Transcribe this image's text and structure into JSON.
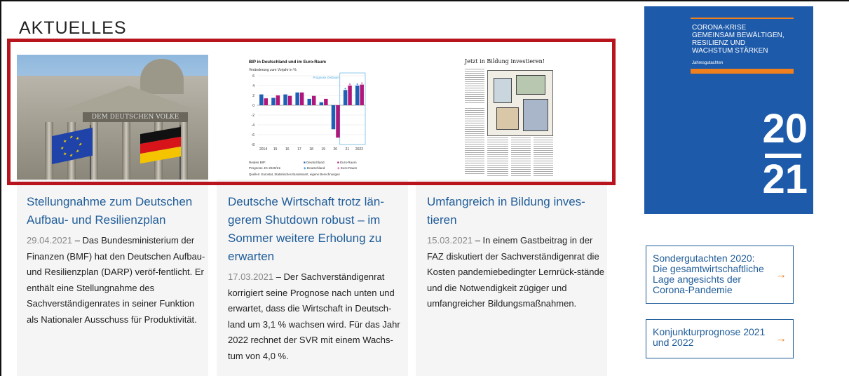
{
  "section": {
    "title": "AKTUELLES"
  },
  "articles": [
    {
      "title": "Stellungnahme zum Deutschen Aufbau- und Resilienzplan",
      "date": "29.04.2021",
      "text": " – Das Bundesministerium der Finanzen (BMF) hat den Deutschen Aufbau- und Resilienzplan (DARP) veröf-fentlicht. Er enthält eine Stellungnahme des Sachverständigenrates in seiner Funktion als Nationaler Ausschuss für Produktivität.",
      "image_caption": "DEM DEUTSCHEN VOLKE"
    },
    {
      "title": "Deutsche Wirtschaft trotz län-gerem Shutdown robust – im Sommer weitere Erholung zu erwarten",
      "date": "17.03.2021",
      "text": " – Der Sachverständigenrat korrigiert seine Prognose nach unten und erwartet, dass die Wirtschaft in Deutsch-land um 3,1 % wachsen wird. Für das Jahr 2022 rechnet der SVR mit einem Wachs-tum von 4,0 %."
    },
    {
      "title": "Umfangreich in Bildung inves-tieren",
      "date": "15.03.2021",
      "text": " – In einem Gastbeitrag in der FAZ diskutiert der Sachverständigenrat die Kosten pandemiebedingter Lernrück-stände und die Notwendigkeit zügiger und umfangreicher Bildungsmaßnahmen.",
      "image_headline": "Jetzt in Bildung investieren!"
    }
  ],
  "chart_data": {
    "type": "bar",
    "title": "BIP in Deutschland und im Euro-Raum",
    "ylabel": "Veränderung zum Vorjahr in %",
    "categories": [
      "2014",
      "15",
      "16",
      "17",
      "18",
      "19",
      "20",
      "21",
      "2022"
    ],
    "ylim": [
      -8,
      6
    ],
    "yticks": [
      "6",
      "4",
      "2",
      "0",
      "-2",
      "-4",
      "-6",
      "-8"
    ],
    "series": [
      {
        "name": "Deutschland",
        "values": [
          2.2,
          1.5,
          2.2,
          2.6,
          1.3,
          0.6,
          -4.9,
          3.1,
          4.0
        ]
      },
      {
        "name": "Euro-Raum",
        "values": [
          1.4,
          2.0,
          1.9,
          2.6,
          1.9,
          1.3,
          -6.6,
          4.0,
          4.2
        ]
      }
    ],
    "prognose_label": "Prognose Zeitraum",
    "legend": {
      "row1_label": "Reales BIP:",
      "row2_label": "Prognose JG 2020/21:",
      "de": "Deutschland",
      "eu": "Euro-Raum"
    },
    "source": "Quellen: Eurostat, Statistisches Bundesamt, eigene Berechnungen",
    "colors": {
      "de": "#1f5fb5",
      "eu": "#b0177a",
      "prognose_de": "#47a7e0",
      "prognose_eu": "#e07ab8"
    }
  },
  "report": {
    "lines": [
      "CORONA-KRISE",
      "GEMEINSAM BEWÄLTIGEN,",
      "RESILIENZ UND",
      "WACHSTUM STÄRKEN"
    ],
    "subtitle": "Jahresgutachten",
    "year_top": "20",
    "year_bottom": "21"
  },
  "side_links": [
    {
      "label": "Sondergutachten 2020: Die gesamtwirtschaftliche Lage angesichts der Corona-Pandemie",
      "arrow": "→"
    },
    {
      "label": "Konjunkturprognose 2021 und 2022",
      "arrow": "→"
    }
  ],
  "colors": {
    "link": "#1f5c99",
    "highlight": "#b7141e",
    "accent": "#f07f1e",
    "cover": "#1d5aaa"
  }
}
